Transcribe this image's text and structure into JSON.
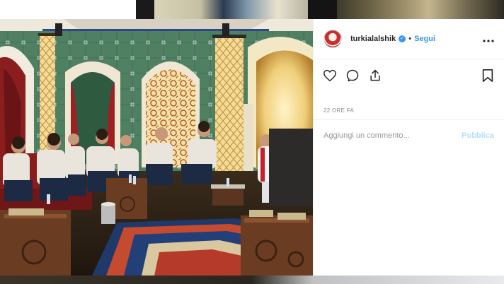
{
  "post": {
    "username": "turkialalshik",
    "separator": "•",
    "follow_label": "Segui",
    "more_label": "•••",
    "timestamp": "22 ORE FA",
    "comment": {
      "placeholder": "Aggiungi un commento...",
      "publish_label": "Pubblica"
    },
    "verified_glyph": "✓"
  },
  "icons": {
    "like": "heart-icon",
    "comment": "comment-bubble-icon",
    "share": "share-icon",
    "save": "bookmark-icon"
  },
  "colors": {
    "link_blue": "#3897f0",
    "publish_disabled": "#b2dffc",
    "muted_text": "#8e8e8e",
    "text": "#262626"
  }
}
